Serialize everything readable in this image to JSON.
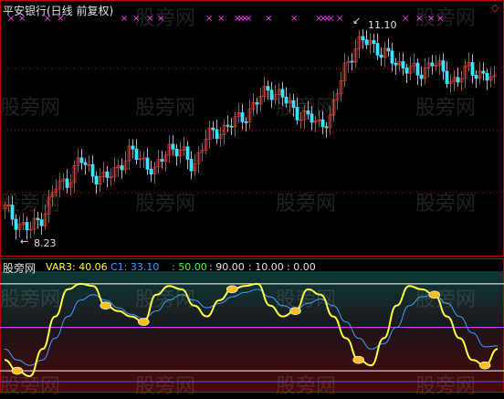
{
  "title": "平安银行(日线 前复权)",
  "watermark": "股旁网",
  "top_panel": {
    "high_label": "11.10",
    "low_label": "8.23"
  },
  "indicator": {
    "name": "股旁网",
    "var3_label": "VAR3: 40.06",
    "c1_label": "C1: 33.10",
    "level_50": ": 50.00",
    "level_90": ": 90.00",
    "level_10": ": 10.00",
    "level_0": ": 0.00"
  },
  "colors": {
    "title": "#d0d0d0",
    "up_candle": "#ff3030",
    "down_candle": "#40e0ff",
    "var3": "#ffff40",
    "c1": "#3aa0ff",
    "level_50": "#40ff40",
    "frame": "#c00000",
    "signal_top": "#ff40ff"
  },
  "chart_data": [
    {
      "type": "candlestick",
      "title": "平安银行(日线 前复权)",
      "annotations": [
        {
          "text": "11.10"
        },
        {
          "text": "8.23"
        }
      ],
      "approx_close": [
        8.6,
        8.4,
        8.3,
        8.5,
        8.9,
        9.0,
        9.3,
        9.1,
        9.0,
        9.2,
        9.4,
        9.3,
        9.1,
        9.5,
        9.4,
        9.2,
        9.6,
        9.7,
        9.8,
        9.9,
        10.1,
        10.3,
        10.2,
        10.0,
        9.9,
        9.8,
        9.9,
        10.6,
        10.9,
        11.0,
        10.8,
        10.7,
        10.6,
        10.5,
        10.7,
        10.5,
        10.4,
        10.6,
        10.5,
        10.4
      ]
    },
    {
      "type": "line",
      "series": [
        {
          "name": "VAR3",
          "values": [
            20,
            10,
            5,
            30,
            60,
            85,
            90,
            88,
            70,
            65,
            60,
            55,
            80,
            88,
            85,
            70,
            60,
            75,
            85,
            88,
            90,
            70,
            60,
            65,
            85,
            80,
            60,
            40,
            20,
            15,
            40,
            70,
            88,
            85,
            80,
            60,
            40,
            20,
            15,
            30
          ]
        },
        {
          "name": "C1",
          "values": [
            30,
            20,
            15,
            20,
            40,
            60,
            75,
            80,
            75,
            68,
            62,
            58,
            65,
            75,
            80,
            75,
            68,
            72,
            78,
            82,
            85,
            78,
            70,
            66,
            72,
            76,
            70,
            55,
            40,
            30,
            35,
            50,
            70,
            78,
            80,
            72,
            60,
            45,
            32,
            33
          ]
        }
      ],
      "levels": [
        90,
        50,
        10,
        0
      ],
      "ylim": [
        0,
        100
      ]
    }
  ]
}
